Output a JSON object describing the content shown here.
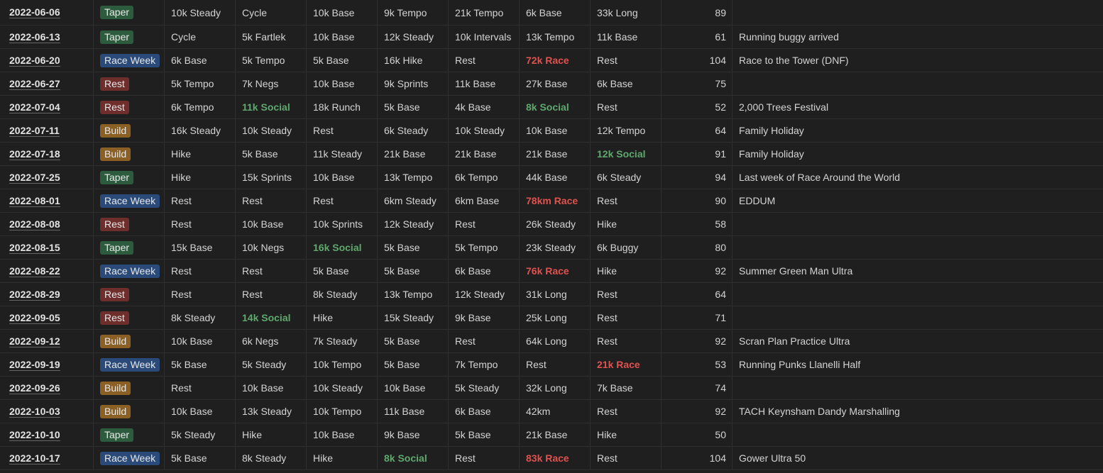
{
  "tag_colors": {
    "Taper": "#2d5b3d",
    "Race Week": "#2a4a7a",
    "Rest": "#6e2e2c",
    "Build": "#8a6025"
  },
  "text_colors": {
    "social": "#5fa86e",
    "race": "#e0524f"
  },
  "rows": [
    {
      "date": "2022-06-06",
      "tag": "Taper",
      "days": [
        "10k Steady",
        "Cycle",
        "10k Base",
        "9k Tempo",
        "21k Tempo",
        "6k Base",
        "33k Long"
      ],
      "total": "89",
      "note": ""
    },
    {
      "date": "2022-06-13",
      "tag": "Taper",
      "days": [
        "Cycle",
        "5k Fartlek",
        "10k Base",
        "12k Steady",
        "10k Intervals",
        "13k Tempo",
        "11k Base"
      ],
      "total": "61",
      "note": "Running buggy arrived"
    },
    {
      "date": "2022-06-20",
      "tag": "Race Week",
      "days": [
        "6k Base",
        "5k Tempo",
        "5k Base",
        "16k Hike",
        "Rest",
        "72k Race",
        "Rest"
      ],
      "total": "104",
      "note": "Race to the Tower (DNF)"
    },
    {
      "date": "2022-06-27",
      "tag": "Rest",
      "days": [
        "5k Tempo",
        "7k Negs",
        "10k Base",
        "9k Sprints",
        "11k Base",
        "27k Base",
        "6k Base"
      ],
      "total": "75",
      "note": ""
    },
    {
      "date": "2022-07-04",
      "tag": "Rest",
      "days": [
        "6k Tempo",
        "11k Social",
        "18k Runch",
        "5k Base",
        "4k Base",
        "8k Social",
        "Rest"
      ],
      "total": "52",
      "note": "2,000 Trees Festival"
    },
    {
      "date": "2022-07-11",
      "tag": "Build",
      "days": [
        "16k Steady",
        "10k Steady",
        "Rest",
        "6k Steady",
        "10k Steady",
        "10k Base",
        "12k Tempo"
      ],
      "total": "64",
      "note": "Family Holiday"
    },
    {
      "date": "2022-07-18",
      "tag": "Build",
      "days": [
        "Hike",
        "5k Base",
        "11k Steady",
        "21k Base",
        "21k Base",
        "21k Base",
        "12k Social"
      ],
      "total": "91",
      "note": "Family Holiday"
    },
    {
      "date": "2022-07-25",
      "tag": "Taper",
      "days": [
        "Hike",
        "15k Sprints",
        "10k Base",
        "13k Tempo",
        "6k Tempo",
        "44k Base",
        "6k Steady"
      ],
      "total": "94",
      "note": "Last week of Race Around the World"
    },
    {
      "date": "2022-08-01",
      "tag": "Race Week",
      "days": [
        "Rest",
        "Rest",
        "Rest",
        "6km Steady",
        "6km Base",
        "78km Race",
        "Rest"
      ],
      "total": "90",
      "note": "EDDUM"
    },
    {
      "date": "2022-08-08",
      "tag": "Rest",
      "days": [
        "Rest",
        "10k Base",
        "10k Sprints",
        "12k Steady",
        "Rest",
        "26k Steady",
        "Hike"
      ],
      "total": "58",
      "note": ""
    },
    {
      "date": "2022-08-15",
      "tag": "Taper",
      "days": [
        "15k Base",
        "10k Negs",
        "16k Social",
        "5k Base",
        "5k Tempo",
        "23k Steady",
        "6k Buggy"
      ],
      "total": "80",
      "note": ""
    },
    {
      "date": "2022-08-22",
      "tag": "Race Week",
      "days": [
        "Rest",
        "Rest",
        "5k Base",
        "5k Base",
        "6k Base",
        "76k Race",
        "Hike"
      ],
      "total": "92",
      "note": "Summer Green Man Ultra"
    },
    {
      "date": "2022-08-29",
      "tag": "Rest",
      "days": [
        "Rest",
        "Rest",
        "8k Steady",
        "13k Tempo",
        "12k Steady",
        "31k Long",
        "Rest"
      ],
      "total": "64",
      "note": ""
    },
    {
      "date": "2022-09-05",
      "tag": "Rest",
      "days": [
        "8k Steady",
        "14k Social",
        "Hike",
        "15k Steady",
        "9k Base",
        "25k Long",
        "Rest"
      ],
      "total": "71",
      "note": ""
    },
    {
      "date": "2022-09-12",
      "tag": "Build",
      "days": [
        "10k Base",
        "6k Negs",
        "7k Steady",
        "5k Base",
        "Rest",
        "64k Long",
        "Rest"
      ],
      "total": "92",
      "note": "Scran Plan Practice Ultra"
    },
    {
      "date": "2022-09-19",
      "tag": "Race Week",
      "days": [
        "5k Base",
        "5k Steady",
        "10k Tempo",
        "5k Base",
        "7k Tempo",
        "Rest",
        "21k Race"
      ],
      "total": "53",
      "note": "Running Punks Llanelli Half"
    },
    {
      "date": "2022-09-26",
      "tag": "Build",
      "days": [
        "Rest",
        "10k Base",
        "10k Steady",
        "10k Base",
        "5k Steady",
        "32k Long",
        "7k Base"
      ],
      "total": "74",
      "note": ""
    },
    {
      "date": "2022-10-03",
      "tag": "Build",
      "days": [
        "10k Base",
        "13k Steady",
        "10k Tempo",
        "11k Base",
        "6k Base",
        "42km",
        "Rest"
      ],
      "total": "92",
      "note": "TACH Keynsham Dandy Marshalling"
    },
    {
      "date": "2022-10-10",
      "tag": "Taper",
      "days": [
        "5k Steady",
        "Hike",
        "10k Base",
        "9k Base",
        "5k Base",
        "21k Base",
        "Hike"
      ],
      "total": "50",
      "note": ""
    },
    {
      "date": "2022-10-17",
      "tag": "Race Week",
      "days": [
        "5k Base",
        "8k Steady",
        "Hike",
        "8k Social",
        "Rest",
        "83k Race",
        "Rest"
      ],
      "total": "104",
      "note": "Gower Ultra 50"
    }
  ]
}
